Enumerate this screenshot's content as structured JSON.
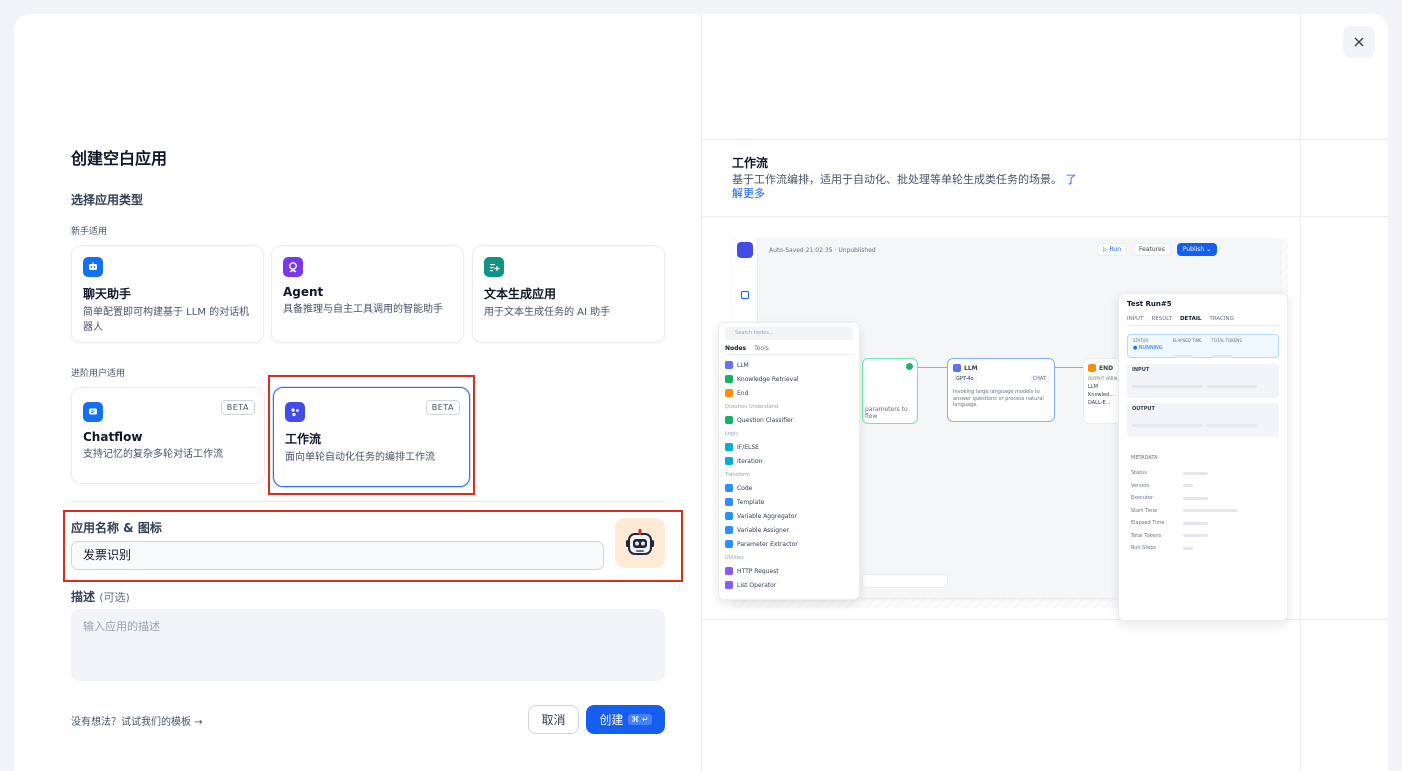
{
  "dialog": {
    "title": "创建空白应用",
    "close_icon": "close-icon"
  },
  "app_type": {
    "section_label": "选择应用类型",
    "beginner_label": "新手适用",
    "advanced_label": "进阶用户适用",
    "cards": [
      {
        "title": "聊天助手",
        "desc": "简单配置即可构建基于 LLM 的对话机器人",
        "icon": "chat-bot-icon",
        "color": "#1570ef"
      },
      {
        "title": "Agent",
        "desc": "具备推理与自主工具调用的智能助手",
        "icon": "agent-icon",
        "color": "#7839ee"
      },
      {
        "title": "文本生成应用",
        "desc": "用于文本生成任务的 AI 助手",
        "icon": "text-generator-icon",
        "color": "#0e9384"
      },
      {
        "title": "Chatflow",
        "desc": "支持记忆的复杂多轮对话工作流",
        "icon": "chatflow-icon",
        "color": "#1570ef",
        "badge": "BETA"
      },
      {
        "title": "工作流",
        "desc": "面向单轮自动化任务的编排工作流",
        "icon": "workflow-icon",
        "color": "#444ce7",
        "badge": "BETA",
        "selected": true
      }
    ]
  },
  "form": {
    "name_label": "应用名称 & 图标",
    "name_value": "发票识别",
    "desc_label": "描述",
    "desc_optional": "(可选)",
    "desc_placeholder": "输入应用的描述",
    "template_link": "没有想法？试试我们的模板 →",
    "cancel_label": "取消",
    "create_label": "创建",
    "create_shortcut": "⌘ ↵"
  },
  "preview": {
    "title": "工作流",
    "desc": "基于工作流编排，适用于自动化、批处理等单轮生成类任务的场景。",
    "more_link": "了解更多",
    "topbar": {
      "autosave": "Auto-Saved 21:02:35 · Unpublished",
      "run": "▷ Run",
      "features": "Features",
      "publish": "Publish ⌄"
    },
    "node_menu": {
      "search": "Search nodes...",
      "tabs": [
        "Nodes",
        "Tools"
      ],
      "groups": [
        {
          "name": "",
          "items": [
            {
              "label": "LLM",
              "color": "#6172f3"
            },
            {
              "label": "Knowledge Retrieval",
              "color": "#16b364"
            },
            {
              "label": "End",
              "color": "#f79009"
            }
          ]
        },
        {
          "name": "Question Understand",
          "items": [
            {
              "label": "Question Classifier",
              "color": "#16b364"
            }
          ]
        },
        {
          "name": "Logic",
          "items": [
            {
              "label": "IF/ELSE",
              "color": "#06aed4"
            },
            {
              "label": "Iteration",
              "color": "#06aed4"
            }
          ]
        },
        {
          "name": "Transform",
          "items": [
            {
              "label": "Code",
              "color": "#2e90fa"
            },
            {
              "label": "Template",
              "color": "#2e90fa"
            },
            {
              "label": "Variable Aggregator",
              "color": "#2e90fa"
            },
            {
              "label": "Variable Assigner",
              "color": "#2e90fa"
            },
            {
              "label": "Parameter Extractor",
              "color": "#2e90fa"
            }
          ]
        },
        {
          "name": "Utilities",
          "items": [
            {
              "label": "HTTP Request",
              "color": "#875bf7"
            },
            {
              "label": "List Operator",
              "color": "#875bf7"
            }
          ]
        }
      ]
    },
    "canvas": {
      "start_node_text": "parameters to\nflow",
      "llm_node": {
        "title": "LLM",
        "model": "GPT-4o",
        "mode": "CHAT",
        "desc": "Invoking large language models to answer questions or process natural language."
      },
      "end_node": {
        "title": "END",
        "output_label": "OUTPUT VARIA...",
        "rows": [
          "LLM",
          "Knowled...",
          "DALL-E..."
        ]
      }
    },
    "test_run": {
      "title": "Test Run#5",
      "tabs": [
        "INPUT",
        "RESULT",
        "DETAIL",
        "TRACING"
      ],
      "active_tab": "DETAIL",
      "status_label": "STATUS",
      "status_value": "● RUNNING",
      "elapsed_label": "ELAPSED TIME",
      "tokens_label": "TOTAL TOKENS",
      "input_label": "INPUT",
      "output_label": "OUTPUT",
      "metadata_label": "METADATA",
      "metadata_rows": [
        "Status",
        "Version",
        "Executor",
        "Start Time",
        "Elapsed Time",
        "Total Tokens",
        "Run Steps"
      ]
    }
  }
}
